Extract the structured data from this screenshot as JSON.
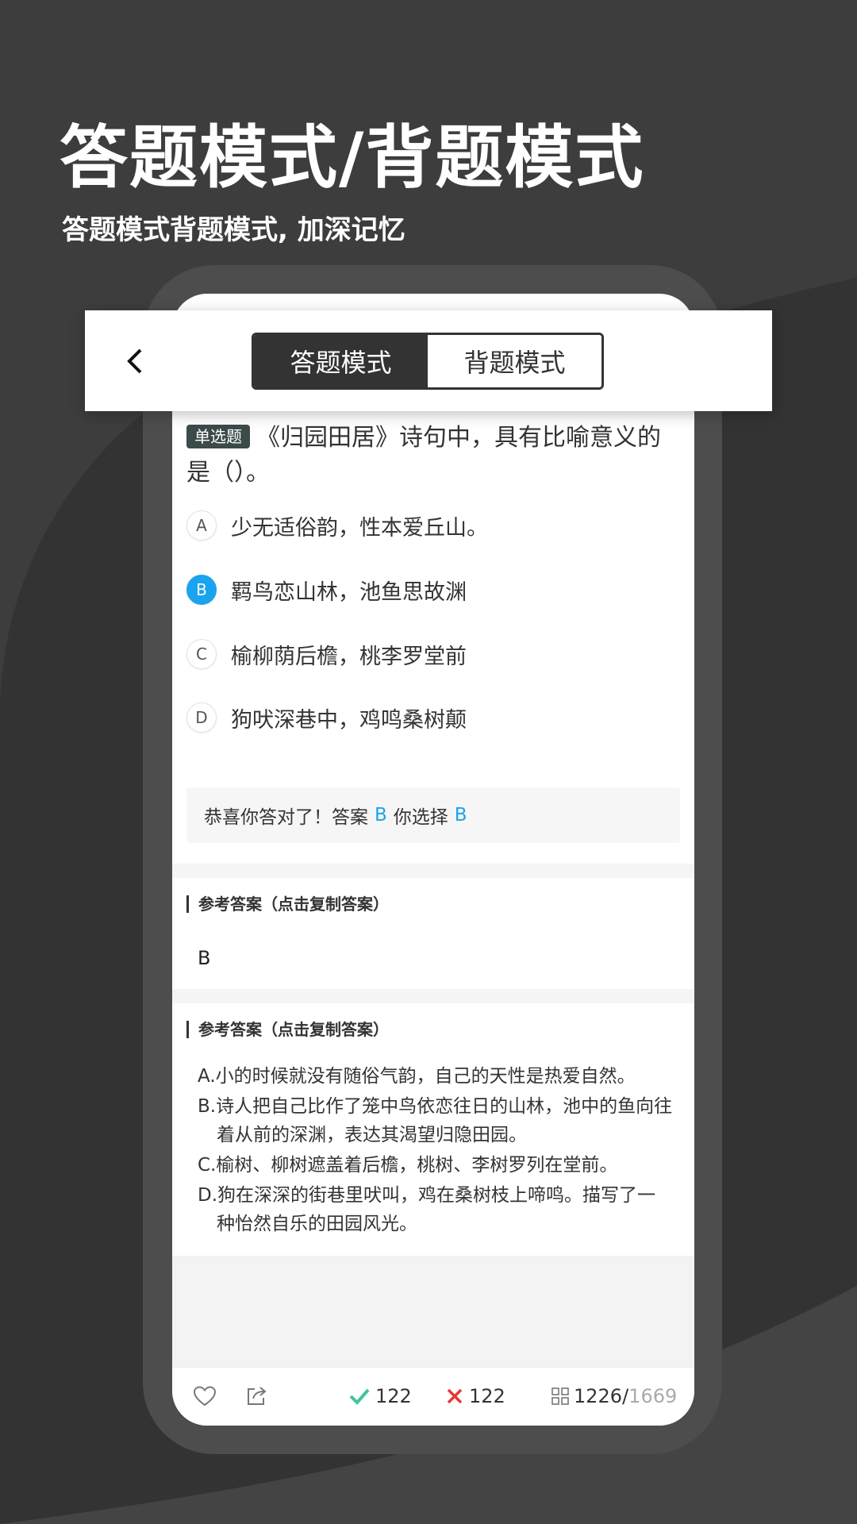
{
  "promo": {
    "headline": "答题模式/背题模式",
    "subheadline": "答题模式背题模式, 加深记忆"
  },
  "topbar": {
    "back_icon": "chevron-left-icon",
    "tabs": [
      {
        "label": "答题模式",
        "active": true
      },
      {
        "label": "背题模式",
        "active": false
      }
    ]
  },
  "question": {
    "type_badge": "单选题",
    "text": "《归园田居》诗句中，具有比喻意义的是（）。",
    "options": [
      {
        "letter": "A",
        "text": "少无适俗韵，性本爱丘山。",
        "selected": false
      },
      {
        "letter": "B",
        "text": "羁鸟恋山林，池鱼思故渊",
        "selected": true
      },
      {
        "letter": "C",
        "text": "榆柳荫后檐，桃李罗堂前",
        "selected": false
      },
      {
        "letter": "D",
        "text": "狗吠深巷中，鸡鸣桑树颠",
        "selected": false
      }
    ]
  },
  "result": {
    "prefix": "恭喜你答对了！答案",
    "answer": "B",
    "middle": "你选择",
    "chosen": "B"
  },
  "reference": {
    "title": "参考答案（点击复制答案）",
    "value": "B"
  },
  "analysis": {
    "title": "参考答案（点击复制答案）",
    "lines": [
      "A.小的时候就没有随俗气韵，自己的天性是热爱自然。",
      "B.诗人把自己比作了笼中鸟依恋往日的山林，池中的鱼向往着从前的深渊，表达其渴望归隐田园。",
      "C.榆树、柳树遮盖着后檐，桃树、李树罗列在堂前。",
      "D.狗在深深的街巷里吠叫，鸡在桑树枝上啼鸣。描写了一种怡然自乐的田园风光。"
    ]
  },
  "bottombar": {
    "favorite_icon": "heart-icon",
    "share_icon": "share-icon",
    "correct_count": "122",
    "wrong_count": "122",
    "progress_current": "1226",
    "progress_separator": "/",
    "progress_total": "1669"
  },
  "colors": {
    "background": "#3d3d3d",
    "accent_blue": "#1aa3ee",
    "correct_green": "#3cc4a0",
    "wrong_red": "#e53935"
  }
}
